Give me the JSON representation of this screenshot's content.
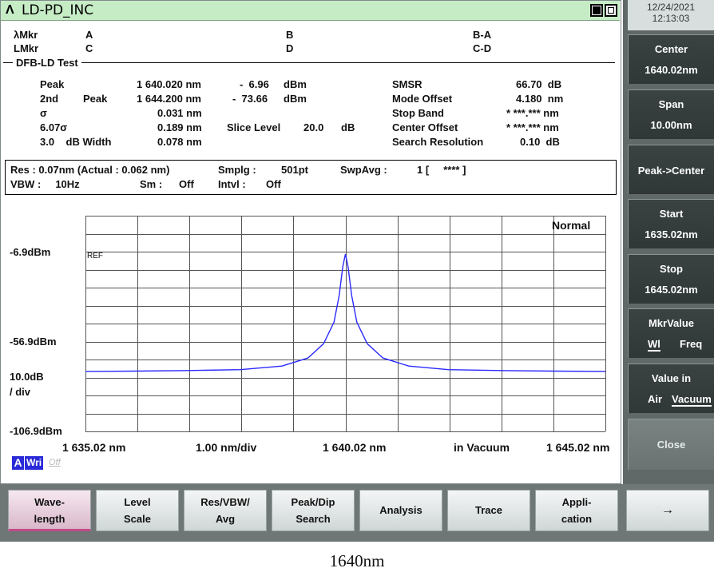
{
  "window": {
    "title": "LD-PD_INC",
    "logo": "Λ"
  },
  "markers": {
    "lambda_mkr": "λMkr",
    "l_mkr": "LMkr",
    "a": "A",
    "b": "B",
    "c": "C",
    "d": "D",
    "ba": "B-A",
    "cd": "C-D"
  },
  "test": {
    "heading": "DFB-LD Test",
    "peak_label": "Peak",
    "peak_wl": "1 640.020 nm",
    "peak_lvl": "-  6.96",
    "peak_unit": "dBm",
    "second_label": "2nd",
    "second_peak_label": "Peak",
    "second_wl": "1 644.200 nm",
    "second_lvl": "-  73.66",
    "second_unit": "dBm",
    "sigma_label": "σ",
    "sigma_val": "0.031 nm",
    "sigma6_label": "6.07σ",
    "sigma6_val": "0.189 nm",
    "slice_label": "Slice Level",
    "slice_val": "20.0",
    "slice_unit": "dB",
    "width_label": "3.0    dB Width",
    "width_val": "0.078 nm",
    "smsr_label": "SMSR",
    "smsr_val": "66.70  dB",
    "mode_label": "Mode Offset",
    "mode_val": "4.180  nm",
    "stop_label": "Stop Band",
    "stop_val": "* ***.*** nm",
    "center_label": "Center Offset",
    "center_val": "* ***.*** nm",
    "res_label": "Search Resolution",
    "res_val": "0.10  dB"
  },
  "settings": {
    "res": "Res : 0.07nm (Actual : 0.062 nm)",
    "smplg_label": "Smplg :",
    "smplg_val": "501pt",
    "swpavg_label": "SwpAvg :",
    "swpavg_val": "1 [     **** ]",
    "vbw": "VBW :     10Hz",
    "sm_label": "Sm :",
    "sm_val": "Off",
    "intvl_label": "Intvl :",
    "intvl_val": "Off"
  },
  "graph": {
    "mode": "Normal",
    "ref": "REF",
    "y_top": "-6.9dBm",
    "y_mid": "-56.9dBm",
    "y_scale_1": "10.0dB",
    "y_scale_2": "/ div",
    "y_bot": "-106.9dBm",
    "x_start": "1 635.02 nm",
    "x_div": "1.00 nm/div",
    "x_center": "1 640.02 nm",
    "x_medium": "in Vacuum",
    "x_stop": "1 645.02 nm",
    "trace_badge": "A",
    "trace_mode": "Wri",
    "trace_state": "Off",
    "trace_color": "#2a2aff"
  },
  "chart_data": {
    "type": "line",
    "x_unit": "nm",
    "y_unit": "dBm",
    "xlim": [
      1635.02,
      1645.02
    ],
    "ylim": [
      -106.9,
      -6.9
    ],
    "x": [
      1635.02,
      1636.0,
      1637.0,
      1638.0,
      1638.8,
      1639.3,
      1639.6,
      1639.8,
      1639.9,
      1639.97,
      1640.02,
      1640.07,
      1640.14,
      1640.24,
      1640.44,
      1640.74,
      1641.24,
      1642.0,
      1643.0,
      1644.0,
      1645.02
    ],
    "y": [
      -72.5,
      -72.3,
      -72.0,
      -71.5,
      -69.5,
      -65.0,
      -57.0,
      -45.0,
      -30.0,
      -14.0,
      -6.96,
      -14.0,
      -30.0,
      -45.0,
      -57.0,
      -65.0,
      -69.5,
      -71.5,
      -72.0,
      -72.3,
      -72.5
    ]
  },
  "datetime": {
    "date": "12/24/2021",
    "time": "12:13:03"
  },
  "side_menu": [
    {
      "line1": "Center",
      "line2": "1640.02nm"
    },
    {
      "line1": "Span",
      "line2": "10.00nm"
    },
    {
      "line1": "Peak->Center",
      "line2": ""
    },
    {
      "line1": "Start",
      "line2": "1635.02nm"
    },
    {
      "line1": "Stop",
      "line2": "1645.02nm"
    },
    {
      "line1": "MkrValue",
      "opt_a": "Wl",
      "opt_b": "Freq"
    },
    {
      "line1": "Value in",
      "opt_a": "Air",
      "opt_b": "Vacuum"
    },
    {
      "line1": "Close",
      "line2": ""
    }
  ],
  "bottom_menu": [
    {
      "line1": "Wave-",
      "line2": "length"
    },
    {
      "line1": "Level",
      "line2": "Scale"
    },
    {
      "line1": "Res/VBW/",
      "line2": "Avg"
    },
    {
      "line1": "Peak/Dip",
      "line2": "Search"
    },
    {
      "line1": "Analysis",
      "line2": ""
    },
    {
      "line1": "Trace",
      "line2": ""
    },
    {
      "line1": "Appli-",
      "line2": "cation"
    },
    {
      "line1": "→",
      "line2": ""
    }
  ],
  "caption": "1640nm"
}
